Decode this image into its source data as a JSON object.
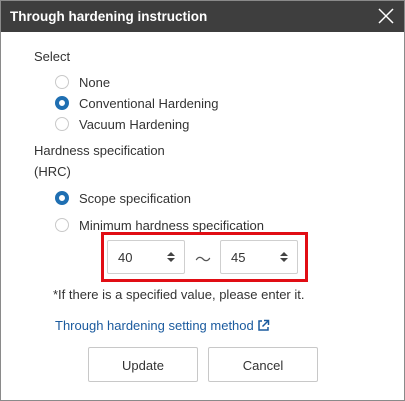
{
  "dialog": {
    "title": "Through hardening instruction",
    "close_icon": "close-icon"
  },
  "select_section": {
    "label": "Select",
    "options": [
      {
        "label": "None",
        "checked": false
      },
      {
        "label": "Conventional Hardening",
        "checked": true
      },
      {
        "label": "Vacuum Hardening",
        "checked": false
      }
    ]
  },
  "hardness_section": {
    "label": "Hardness specification",
    "unit": "(HRC)",
    "options": [
      {
        "label": "Scope specification",
        "checked": true
      },
      {
        "label": "Minimum hardness specification",
        "checked": false
      }
    ],
    "range_min": "40",
    "range_max": "45",
    "range_separator": "～",
    "note": "*If there is a specified value, please enter it."
  },
  "link": {
    "label": "Through hardening setting method",
    "icon": "external-link-icon"
  },
  "buttons": {
    "update": "Update",
    "cancel": "Cancel"
  },
  "colors": {
    "titlebar": "#3e3e3e",
    "accent": "#1f6fb2",
    "highlight": "#e10d14",
    "link": "#1a5a9e"
  }
}
